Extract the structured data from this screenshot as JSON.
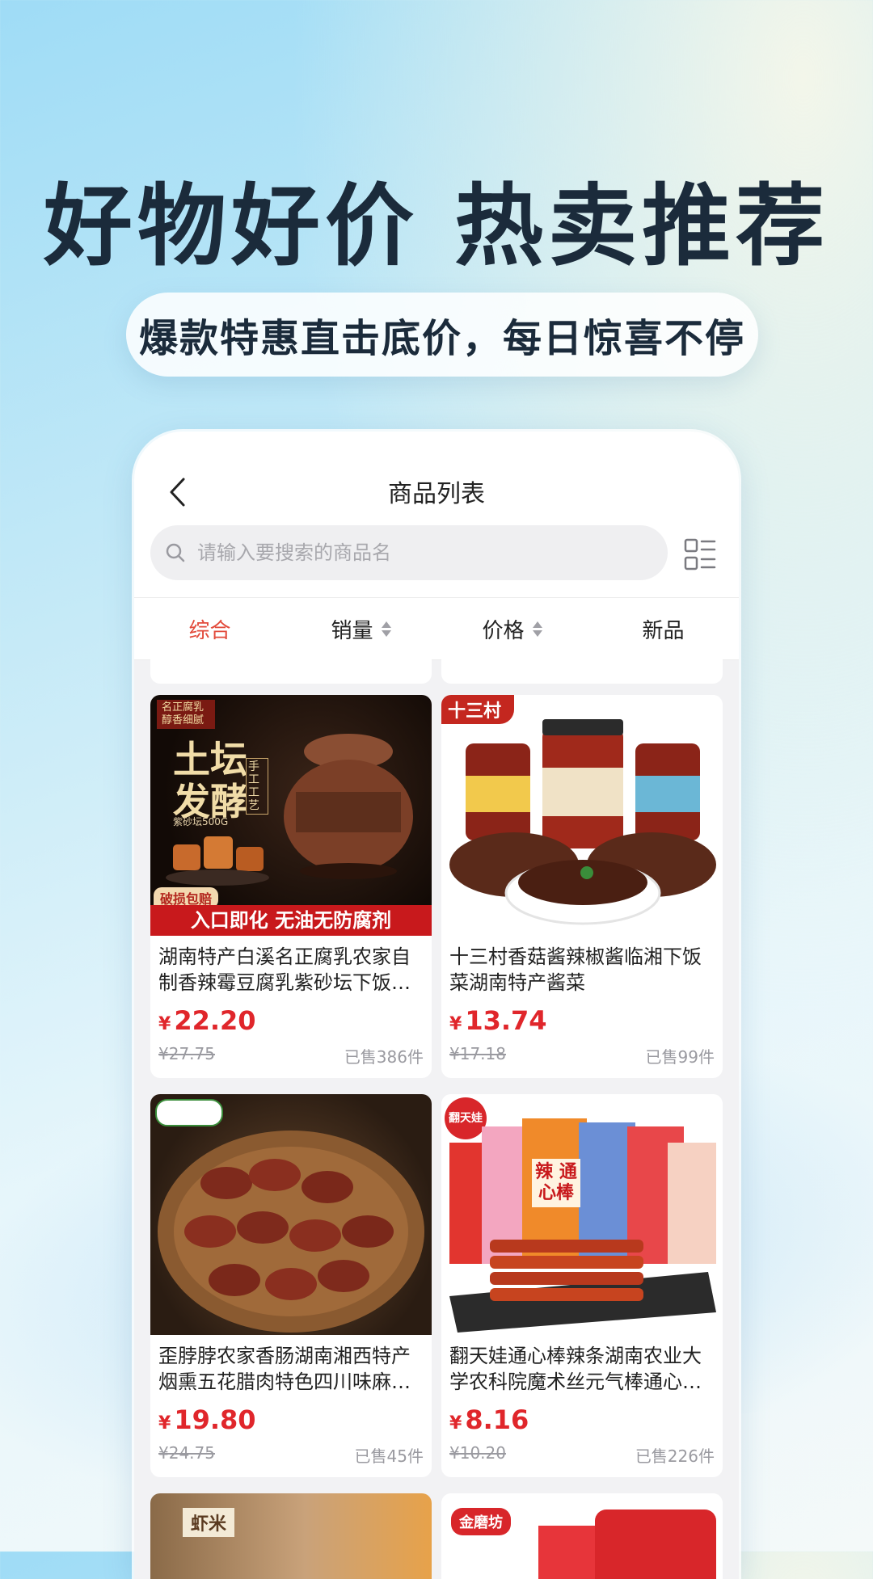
{
  "hero": {
    "title": "好物好价 热卖推荐",
    "subtitle": "爆款特惠直击底价，每日惊喜不停"
  },
  "app": {
    "page_title": "商品列表",
    "search": {
      "placeholder": "请输入要搜索的商品名"
    },
    "filters": [
      {
        "label": "综合",
        "active": true
      },
      {
        "label": "销量",
        "sortable": true
      },
      {
        "label": "价格",
        "sortable": true
      },
      {
        "label": "新品"
      }
    ],
    "currency_symbol": "¥",
    "products": [
      {
        "title": "湖南特产白溪名正腐乳农家自制香辣霉豆腐乳紫砂坛下饭…",
        "price": "22.20",
        "original_price": "¥27.75",
        "sold": "已售386件",
        "image_text": {
          "badge": "名正腐乳 醇香细腻",
          "main1": "土坛",
          "main2": "发酵",
          "side": "手工工艺",
          "small": "紫砂坛500G",
          "tag": "破损包赔",
          "banner": "入口即化 无油无防腐剂"
        }
      },
      {
        "title": "十三村香菇酱辣椒酱临湘下饭菜湖南特产酱菜",
        "price": "13.74",
        "original_price": "¥17.18",
        "sold": "已售99件",
        "image_text": {
          "badge": "十三村"
        }
      },
      {
        "title": "歪脖脖农家香肠湖南湘西特产烟熏五花腊肉特色四川味麻…",
        "price": "19.80",
        "original_price": "¥24.75",
        "sold": "已售45件",
        "image_text": {}
      },
      {
        "title": "翻天娃通心棒辣条湖南农业大学农科院魔术丝元气棒通心…",
        "price": "8.16",
        "original_price": "¥10.20",
        "sold": "已售226件",
        "image_text": {
          "badge": "翻天娃",
          "pack": "辣 通心棒"
        }
      }
    ],
    "partial_bottom": {
      "left_text": "虾米",
      "right_text": "金磨坊"
    }
  },
  "colors": {
    "accent": "#e24a3b",
    "price": "#e0262b",
    "title": "#1b2b3b"
  }
}
